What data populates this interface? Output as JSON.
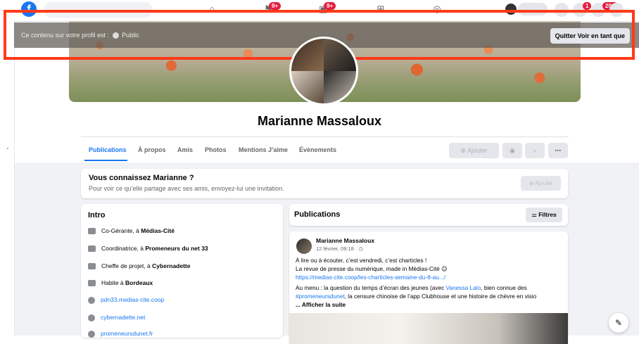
{
  "banner": {
    "text": "Ce contenu sur votre profil est : ",
    "privacy": "Public",
    "quit_button": "Quitter Voir en tant que"
  },
  "nav": {
    "badges": [
      "9+",
      "9+",
      "1",
      "20+"
    ],
    "icons": [
      "home-icon",
      "flag-icon",
      "video-icon",
      "marketplace-icon",
      "groups-icon"
    ]
  },
  "profile": {
    "name": "Marianne Massaloux"
  },
  "tabs": [
    {
      "label": "Publications",
      "active": true
    },
    {
      "label": "À propos"
    },
    {
      "label": "Amis"
    },
    {
      "label": "Photos"
    },
    {
      "label": "Mentions J’aime"
    },
    {
      "label": "Évènements"
    }
  ],
  "toolbar": {
    "add_label": "Ajouter",
    "more_label": "···"
  },
  "know_card": {
    "title": "Vous connaissez Marianne ?",
    "subtitle": "Pour voir ce qu’elle partage avec ses amis, envoyez-lui une invitation.",
    "add_label": "Ajouter"
  },
  "intro": {
    "title": "Intro",
    "rows": [
      {
        "prefix": "Co-Gérante, à ",
        "bold": "Médias-Cité"
      },
      {
        "prefix": "Coordinatrice, à ",
        "bold": "Promeneurs du net 33"
      },
      {
        "prefix": "Cheffe de projet, à ",
        "bold": "Cybernadette"
      },
      {
        "prefix": "Habite à ",
        "bold": "Bordeaux"
      }
    ],
    "links": [
      "pdn33.medias-cite.coop",
      "cybernadette.net",
      "promeneursdunet.fr"
    ]
  },
  "publications": {
    "title": "Publications",
    "filter_label": "Filtres"
  },
  "post": {
    "author": "Marianne Massaloux",
    "date": "12 février, 09:18 · ",
    "line1": "À lire ou à écouter, c’est vendredi, c’est charticles !",
    "line2": "La revue de presse du numérique, made in Médias-Cité 😉",
    "line3_link": "https://medias-cite.coop/les-charticles-semaine-du-8-au.../",
    "line4_pre": "Au menu : la question du temps d’écran des jeunes (avec ",
    "line4_link": "Vanessa Lalo",
    "line4_post": ", bien connue des",
    "line5_link": "#promeneursdunet",
    "line5_post": ", la censure chinoise de l’app Clubhouse et une histoire de chèvre en visio",
    "line6_pre": "... ",
    "line6_more": "... Afficher la suite"
  },
  "colors": {
    "accent": "#1877f2",
    "highlight": "#ff3a1a",
    "badge": "#e41e3f"
  }
}
